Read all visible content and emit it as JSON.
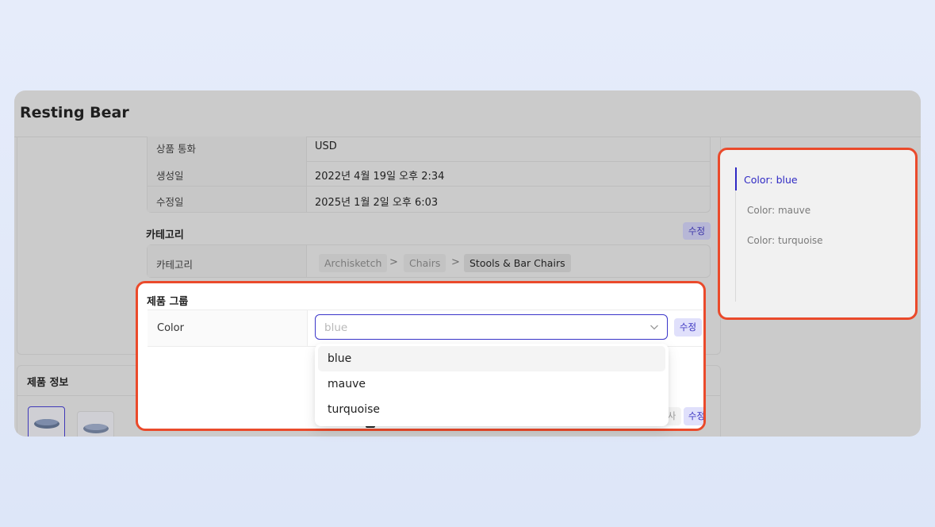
{
  "app": {
    "title": "Resting Bear"
  },
  "info_table": {
    "rows": [
      {
        "label": "상품 통화",
        "value": "USD"
      },
      {
        "label": "생성일",
        "value": "2022년 4월 19일 오후 2:34"
      },
      {
        "label": "수정일",
        "value": "2025년 1월 2일 오후 6:03"
      }
    ]
  },
  "category": {
    "section_title": "카테고리",
    "edit_label": "수정",
    "row_label": "카테고리",
    "path": [
      "Archisketch",
      "Chairs",
      "Stools & Bar Chairs"
    ],
    "separator": ">"
  },
  "product_info": {
    "section_title": "제품 정보"
  },
  "product_group": {
    "section_title": "제품 그룹",
    "row_label": "Color",
    "selected_value": "blue",
    "edit_label": "수정",
    "options": [
      "blue",
      "mauve",
      "turquoise"
    ],
    "hover_option": "blue",
    "bottom_ghost_label": "사",
    "bottom_edit_label": "수정"
  },
  "toc": {
    "items": [
      "Color: blue",
      "Color: mauve",
      "Color: turquoise"
    ],
    "active_index": 0
  },
  "colors": {
    "accent": "#2f29c4",
    "highlight": "#ea4a2b"
  }
}
